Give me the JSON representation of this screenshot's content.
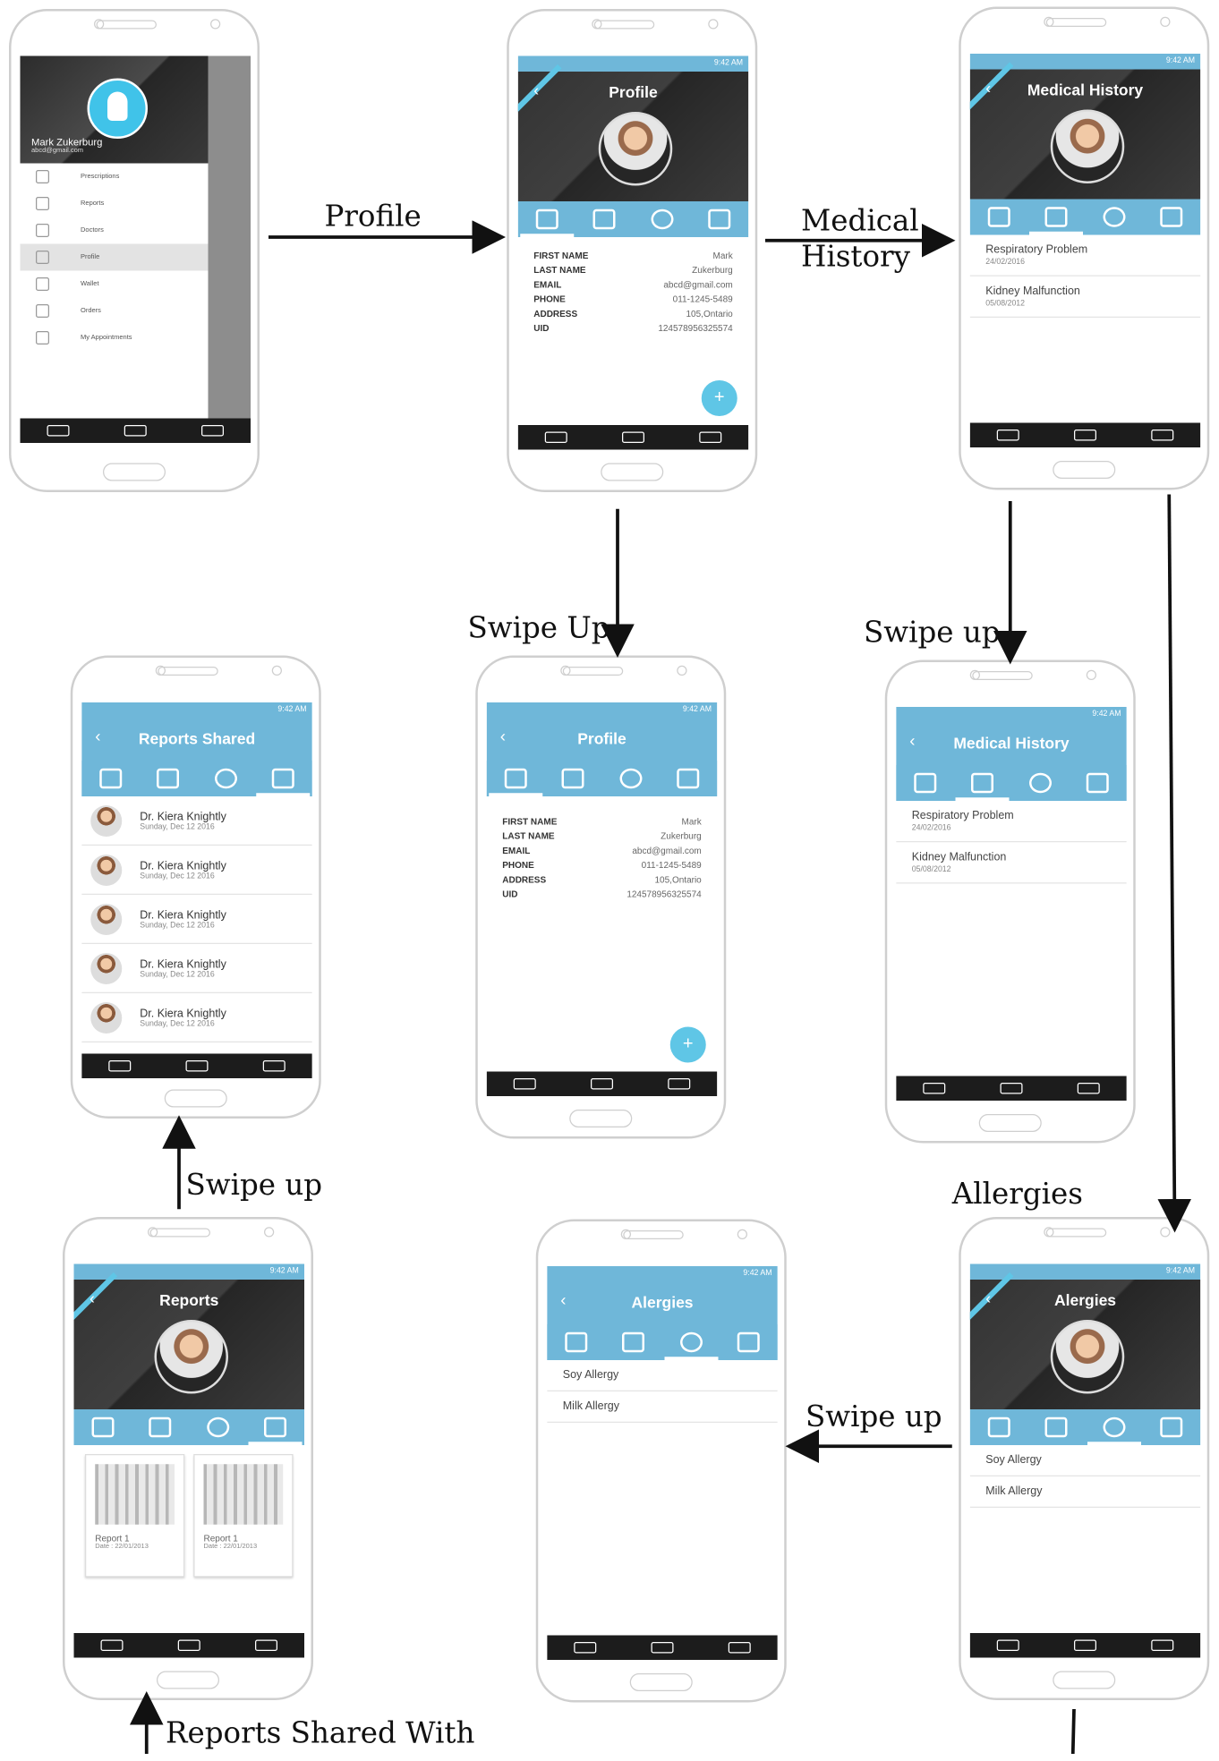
{
  "status_time": "9:42 AM",
  "labels": {
    "profile": "Profile",
    "medical_history_l1": "Medical",
    "medical_history_l2": "History",
    "swipe_up_profile": "Swipe Up",
    "swipe_up_medical": "Swipe up",
    "swipe_up_reports": "Swipe up",
    "allergies": "Allergies",
    "swipe_up_allergies": "Swipe up",
    "reports_shared_with": "Reports Shared With"
  },
  "drawer": {
    "name": "Mark Zukerburg",
    "email": "abcd@gmail.com",
    "items": [
      "Prescriptions",
      "Reports",
      "Doctors",
      "Profile",
      "Wallet",
      "Orders",
      "My Appointments"
    ]
  },
  "profile": {
    "title": "Profile",
    "fields": [
      {
        "k": "FIRST NAME",
        "v": "Mark"
      },
      {
        "k": "LAST NAME",
        "v": "Zukerburg"
      },
      {
        "k": "EMAIL",
        "v": "abcd@gmail.com"
      },
      {
        "k": "PHONE",
        "v": "011-1245-5489"
      },
      {
        "k": "ADDRESS",
        "v": "105,Ontario"
      },
      {
        "k": "UID",
        "v": "124578956325574"
      }
    ],
    "fab": "+"
  },
  "medical": {
    "title": "Medical History",
    "items": [
      {
        "t": "Respiratory Problem",
        "d": "24/02/2016"
      },
      {
        "t": "Kidney Malfunction",
        "d": "05/08/2012"
      }
    ]
  },
  "reports_shared": {
    "title": "Reports Shared",
    "rows": [
      {
        "t": "Dr. Kiera Knightly",
        "d": "Sunday, Dec 12 2016"
      },
      {
        "t": "Dr. Kiera Knightly",
        "d": "Sunday, Dec 12 2016"
      },
      {
        "t": "Dr. Kiera Knightly",
        "d": "Sunday, Dec 12 2016"
      },
      {
        "t": "Dr. Kiera Knightly",
        "d": "Sunday, Dec 12 2016"
      },
      {
        "t": "Dr. Kiera Knightly",
        "d": "Sunday, Dec 12 2016"
      }
    ]
  },
  "reports": {
    "title": "Reports",
    "cards": [
      {
        "t": "Report 1",
        "d": "Date : 22/01/2013"
      },
      {
        "t": "Report 1",
        "d": "Date : 22/01/2013"
      }
    ]
  },
  "allergies": {
    "title": "Alergies",
    "items": [
      "Soy Allergy",
      "Milk Allergy"
    ]
  }
}
